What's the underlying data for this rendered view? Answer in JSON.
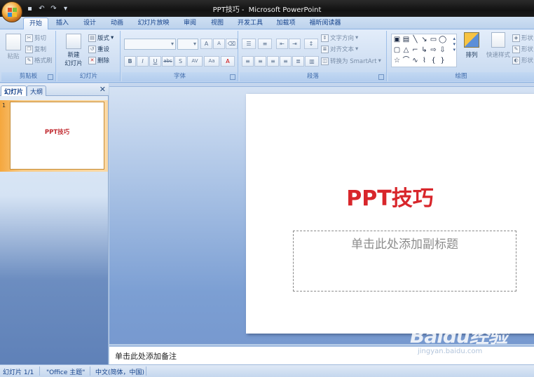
{
  "window": {
    "title_doc": "PPT技巧",
    "title_app": "Microsoft PowerPoint"
  },
  "tabs": [
    "开始",
    "插入",
    "设计",
    "动画",
    "幻灯片放映",
    "审阅",
    "视图",
    "开发工具",
    "加载项",
    "福昕阅读器"
  ],
  "ribbon": {
    "clipboard": {
      "paste": "粘贴",
      "cut": "剪切",
      "copy": "复制",
      "format_painter": "格式刷",
      "label": "剪贴板"
    },
    "slides": {
      "new_slide_1": "新建",
      "new_slide_2": "幻灯片",
      "layout": "版式",
      "reset": "重设",
      "delete": "删除",
      "label": "幻灯片"
    },
    "font": {
      "label": "字体",
      "bold": "B",
      "italic": "I",
      "underline": "U",
      "strike": "abc",
      "shadow": "S",
      "spacing": "AV",
      "case": "Aa",
      "grow": "A",
      "shrink": "A"
    },
    "paragraph": {
      "label": "段落",
      "text_direction": "文字方向",
      "align_text": "对齐文本",
      "smartart": "转换为 SmartArt"
    },
    "drawing": {
      "label": "绘图",
      "arrange": "排列",
      "quick_styles": "快速样式",
      "shape_fill": "形状",
      "shape_outline": "形状",
      "shape_effects": "形状"
    }
  },
  "left_pane": {
    "tab_slides": "幻灯片",
    "tab_outline": "大纲",
    "thumb_number": "1",
    "thumb_title": "PPT技巧"
  },
  "slide": {
    "title": "PPT技巧",
    "subtitle_placeholder": "单击此处添加副标题"
  },
  "notes": {
    "placeholder": "单击此处添加备注"
  },
  "status": {
    "slide_pos": "幻灯片 1/1",
    "theme": "\"Office 主题\"",
    "language": "中文(简体，中国)"
  },
  "watermark": {
    "logo": "Baidu经验",
    "url": "jingyan.baidu.com"
  },
  "colors": {
    "title_red": "#d8262b",
    "ribbon_blue": "#d1e0f3",
    "thumb_orange": "#f5a73e"
  }
}
